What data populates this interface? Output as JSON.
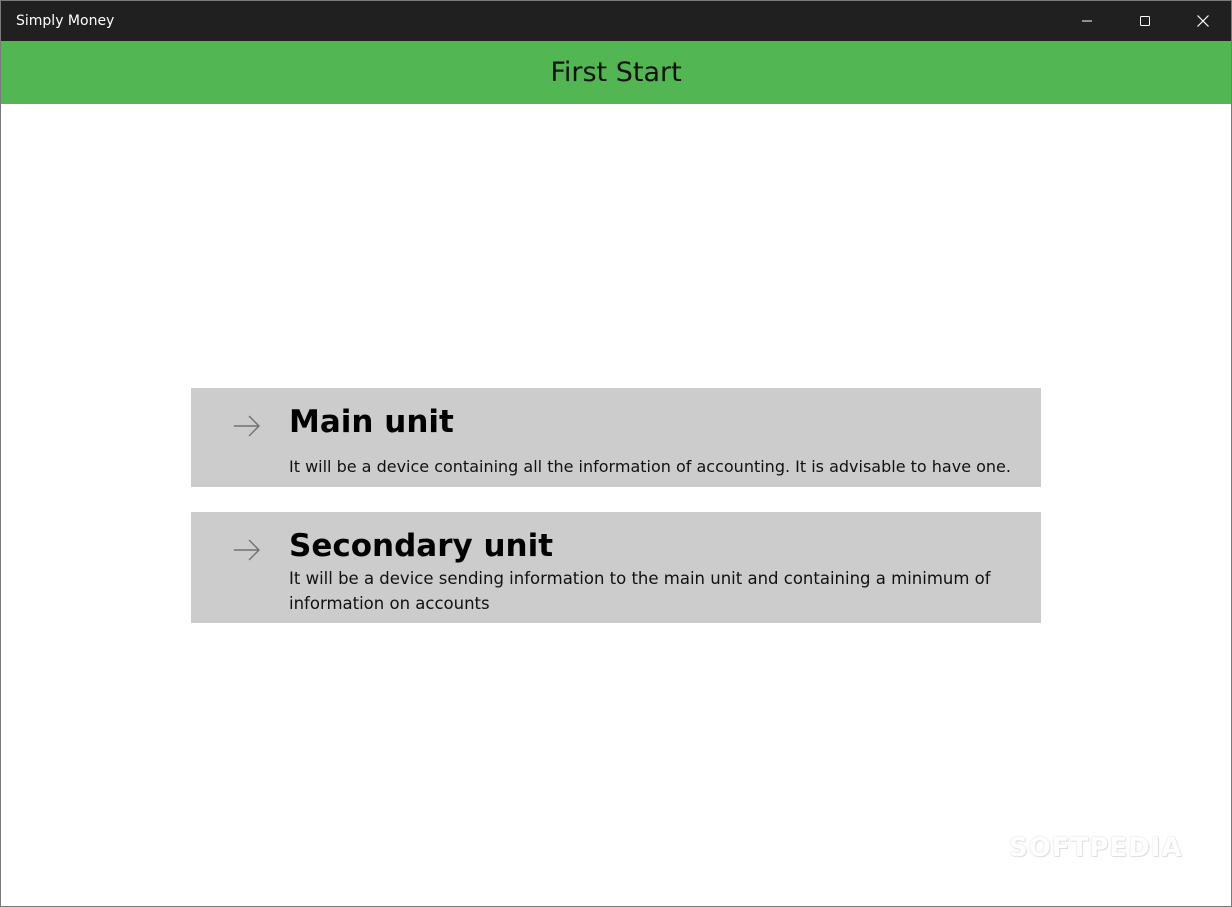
{
  "window": {
    "title": "Simply Money",
    "controls": {
      "minimize_icon": "minimize-icon",
      "maximize_icon": "maximize-icon",
      "close_icon": "close-icon"
    }
  },
  "header": {
    "title": "First Start",
    "background_color": "#52b652"
  },
  "options": [
    {
      "icon": "arrow-right-icon",
      "title": "Main unit",
      "description": "It will be a device containing all the information of accounting. It is advisable to have one."
    },
    {
      "icon": "arrow-right-icon",
      "title": "Secondary unit",
      "description": "It will be a device sending information to the main unit and containing a minimum of information on accounts"
    }
  ],
  "colors": {
    "titlebar": "#202020",
    "option_background": "#cccccc"
  },
  "watermark": "SOFTPEDIA"
}
